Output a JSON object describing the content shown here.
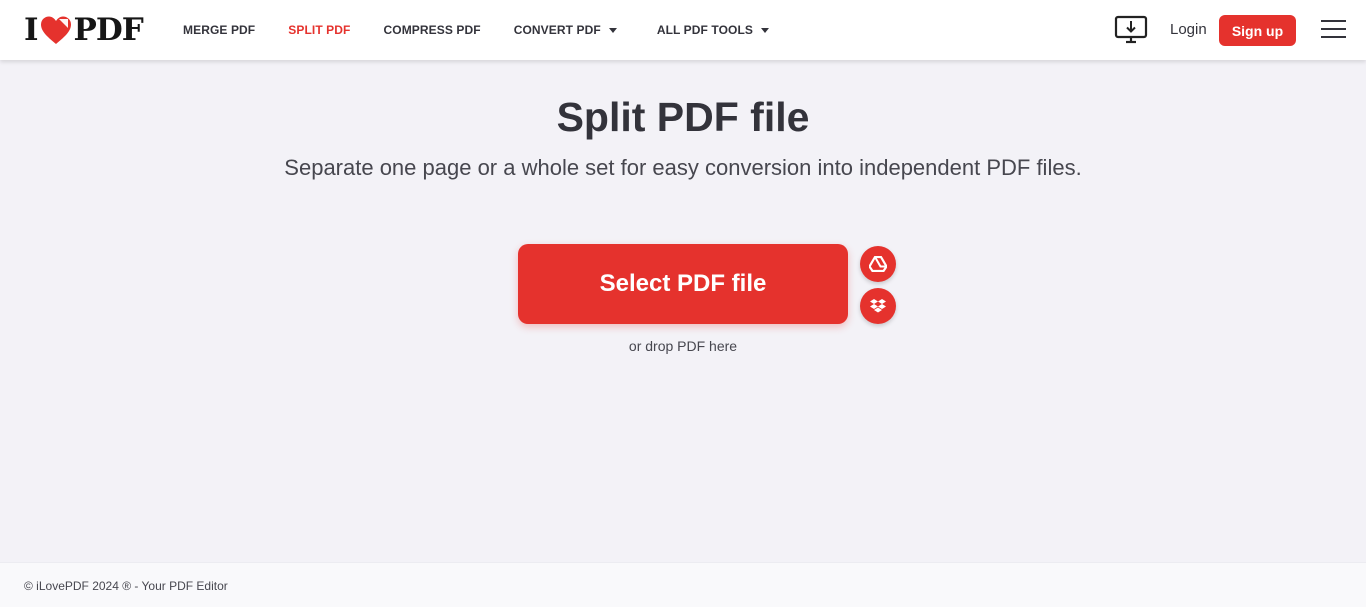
{
  "brand": {
    "logo_text_left": "I",
    "logo_text_right": "PDF",
    "accent_color": "#e5322d"
  },
  "nav": {
    "items": [
      {
        "label": "MERGE PDF",
        "active": false,
        "dropdown": false
      },
      {
        "label": "SPLIT PDF",
        "active": true,
        "dropdown": false
      },
      {
        "label": "COMPRESS PDF",
        "active": false,
        "dropdown": false
      },
      {
        "label": "CONVERT PDF",
        "active": false,
        "dropdown": true
      },
      {
        "label": "ALL PDF TOOLS",
        "active": false,
        "dropdown": true
      }
    ]
  },
  "header_right": {
    "desktop_icon": "desktop-download-icon",
    "login_label": "Login",
    "signup_label": "Sign up",
    "menu_icon": "hamburger-menu-icon"
  },
  "main": {
    "title": "Split PDF file",
    "subtitle": "Separate one page or a whole set for easy conversion into independent PDF files.",
    "select_button_label": "Select PDF file",
    "cloud_buttons": [
      {
        "icon": "google-drive-icon"
      },
      {
        "icon": "dropbox-icon"
      }
    ],
    "drop_text": "or drop PDF here"
  },
  "footer": {
    "text": "© iLovePDF 2024 ® - Your PDF Editor"
  }
}
